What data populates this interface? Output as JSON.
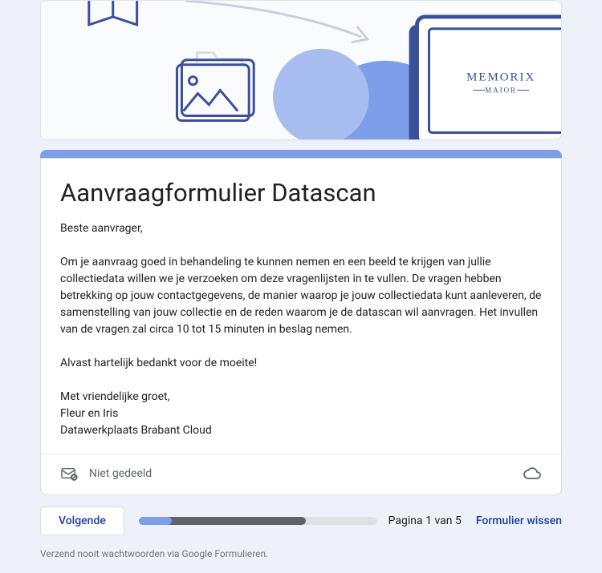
{
  "header": {
    "brand_line1": "MEMORIX",
    "brand_line2": "MAIOR"
  },
  "form": {
    "title": "Aanvraagformulier Datascan",
    "greeting": "Beste aanvrager,",
    "body": "Om je aanvraag goed in behandeling te kunnen nemen en een beeld te krijgen van jullie collectiedata willen we je verzoeken om deze vragenlijsten in te vullen. De vragen hebben betrekking op jouw contactgegevens, de manier waarop je jouw collectiedata kunt aanleveren, de samenstelling van jouw collectie en de reden waarom je de datascan wil aanvragen. Het invullen van de vragen zal circa 10 tot 15 minuten in beslag nemen.",
    "thanks": "Alvast hartelijk bedankt voor de moeite!",
    "signoff": "Met vriendelijke groet,",
    "signer": "Fleur en Iris",
    "org": "Datawerkplaats Brabant Cloud"
  },
  "sharing_status": "Niet gedeeld",
  "nav": {
    "next_label": "Volgende",
    "page_label": "Pagina 1 van 5",
    "clear_label": "Formulier wissen",
    "progress_percent": 14
  },
  "disclaimer": "Verzend nooit wachtwoorden via Google Formulieren."
}
